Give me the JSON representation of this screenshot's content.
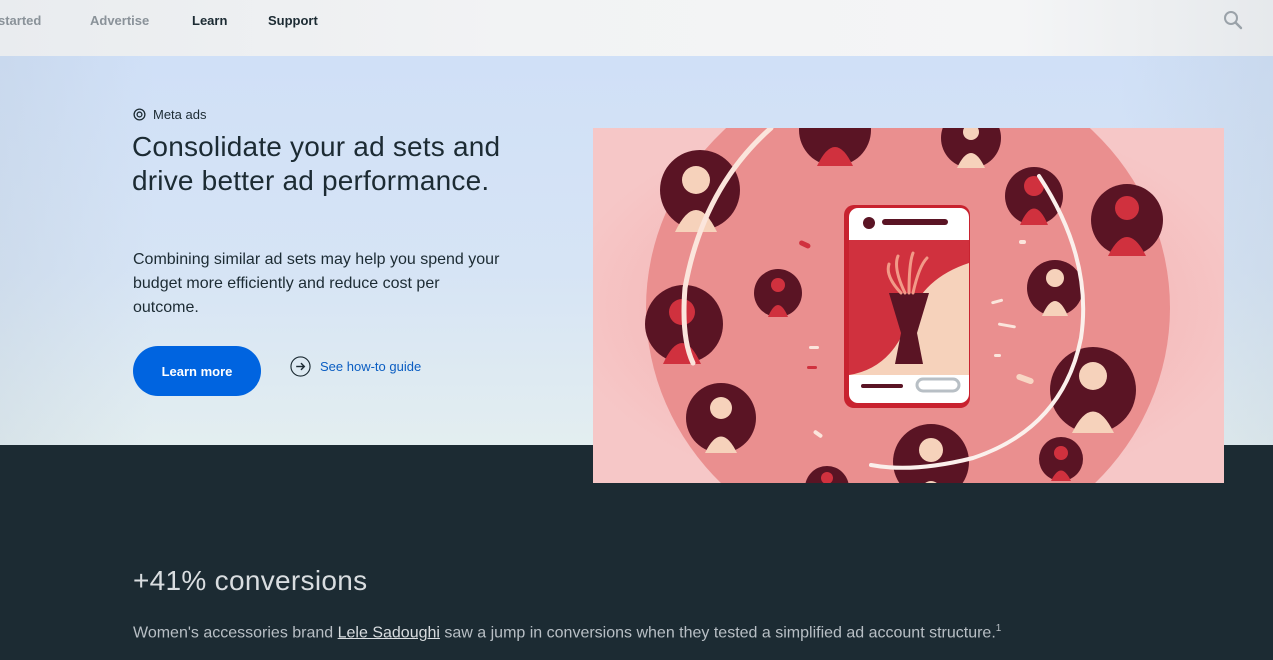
{
  "nav": {
    "items": [
      {
        "label": "started"
      },
      {
        "label": "Advertise"
      },
      {
        "label": "Learn"
      },
      {
        "label": "Support"
      }
    ],
    "search_icon": "search-icon"
  },
  "hero": {
    "eyebrow": "Meta ads",
    "headline": "Consolidate your ad sets and drive better ad performance.",
    "subcopy": "Combining similar ad sets may help you spend your budget more efficiently and reduce cost per outcome.",
    "primary_cta": "Learn more",
    "secondary_cta": "See how-to guide"
  },
  "stat": {
    "title": "+41% conversions",
    "body_before": "Women's accessories brand ",
    "brand_link": "Lele Sadoughi",
    "body_after": " saw a jump in conversions when they tested a simplified ad account structure.",
    "footnote": "1"
  },
  "colors": {
    "primary_blue": "#0064e0",
    "link_blue": "#0a5dc2",
    "dark_bg": "#1c2b33",
    "illustration_pink": "#f3c4c4",
    "avatar_maroon": "#5a1424",
    "avatar_red": "#d0313e"
  }
}
